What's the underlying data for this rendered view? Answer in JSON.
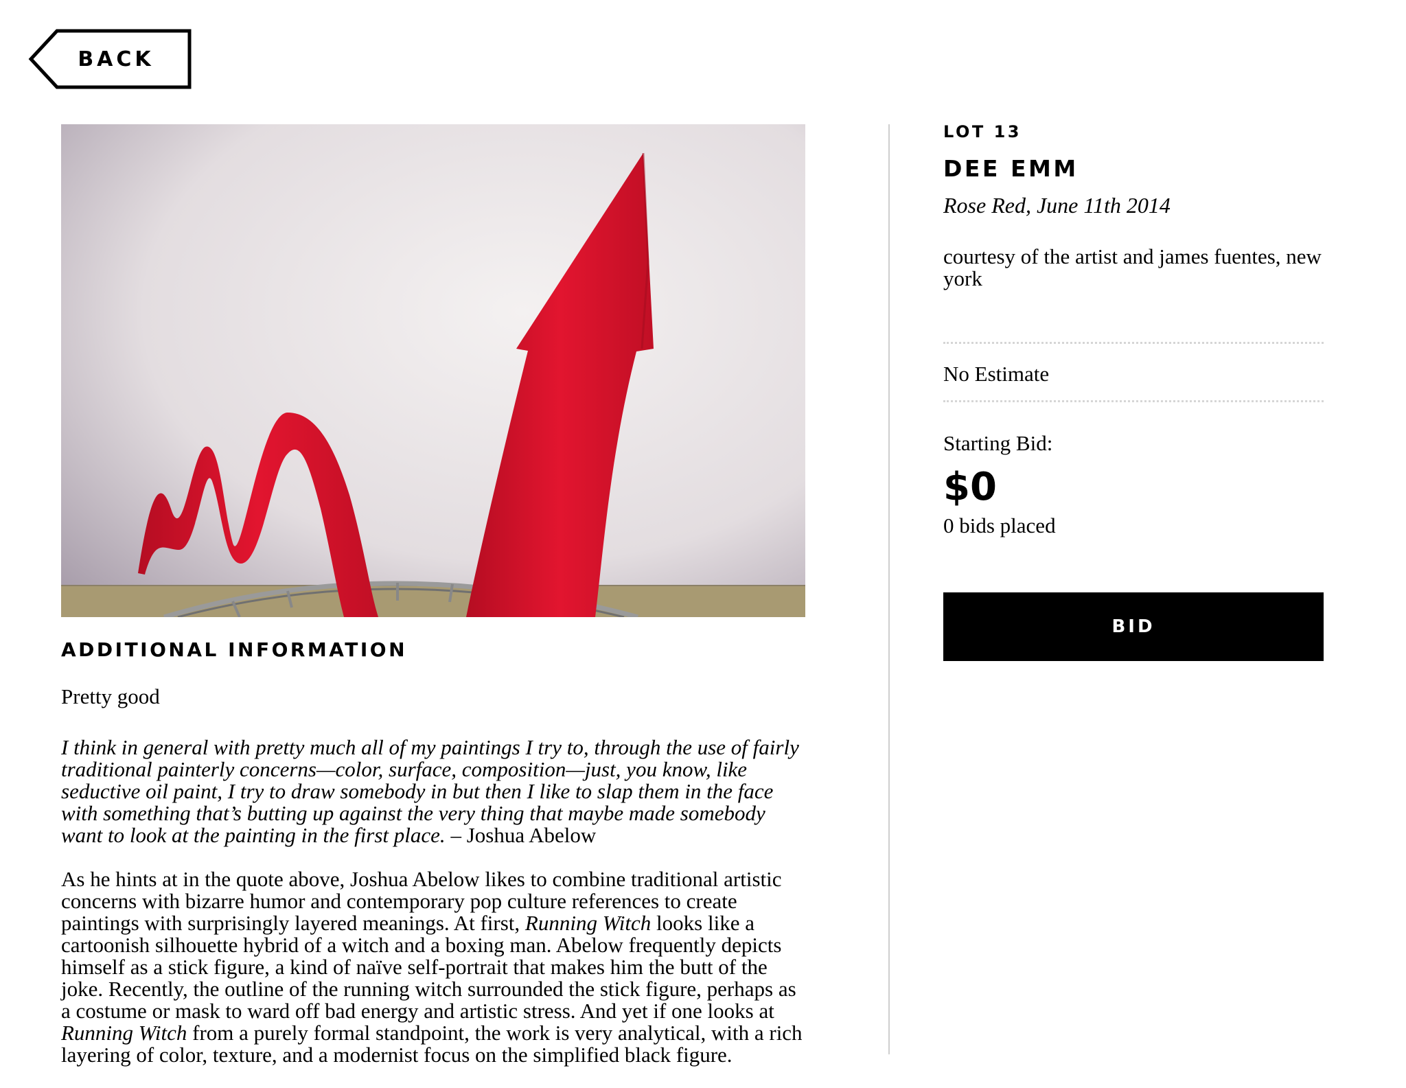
{
  "nav": {
    "back_label": "BACK"
  },
  "artwork": {
    "image_description": ""
  },
  "lot": {
    "lot_label": "LOT 13",
    "artist": "DEE EMM",
    "title": "Rose Red, June 11th 2014",
    "courtesy": "courtesy of the artist and james fuentes, new york",
    "estimate": "No Estimate",
    "starting_bid_label": "Starting Bid:",
    "starting_bid_amount": "$0",
    "bids_placed": "0 bids placed",
    "bid_button_label": "BID"
  },
  "info": {
    "heading": "ADDITIONAL INFORMATION",
    "intro": "Pretty good",
    "quote_italic": "I think in general with pretty much all of my paintings I try to, through the use of fairly traditional painterly concerns—color, surface, composition—just, you know, like seductive oil paint, I try to draw somebody in but then I like to slap them in the face with something that’s butting up against the very thing that maybe made somebody want to look at the painting in the first place.",
    "quote_attribution": " – Joshua Abelow",
    "body_1": "As he hints at in the quote above, Joshua Abelow likes to combine traditional artistic concerns with bizarre humor and contemporary pop culture references to create paintings with surprisingly layered meanings. At first, ",
    "body_work_1": "Running Witch",
    "body_2": " looks like a cartoonish silhouette hybrid of a witch and a boxing man. Abelow frequently depicts himself as a stick figure, a kind of naïve self-portrait that makes him the butt of the joke. Recently, the outline of the running witch surrounded the stick figure, perhaps as a costume or mask to ward off bad energy and artistic stress. And yet if one looks at ",
    "body_work_2": "Running Witch",
    "body_3": " from a purely formal standpoint, the work is very analytical, with a rich layering of color, texture, and a modernist focus on the simplified black figure."
  },
  "colors": {
    "wall": "#e8e2e4",
    "sculpture_red": "#d1122a",
    "floor": "#a89a72",
    "button_bg": "#000000",
    "divider": "#cfcfcf"
  }
}
